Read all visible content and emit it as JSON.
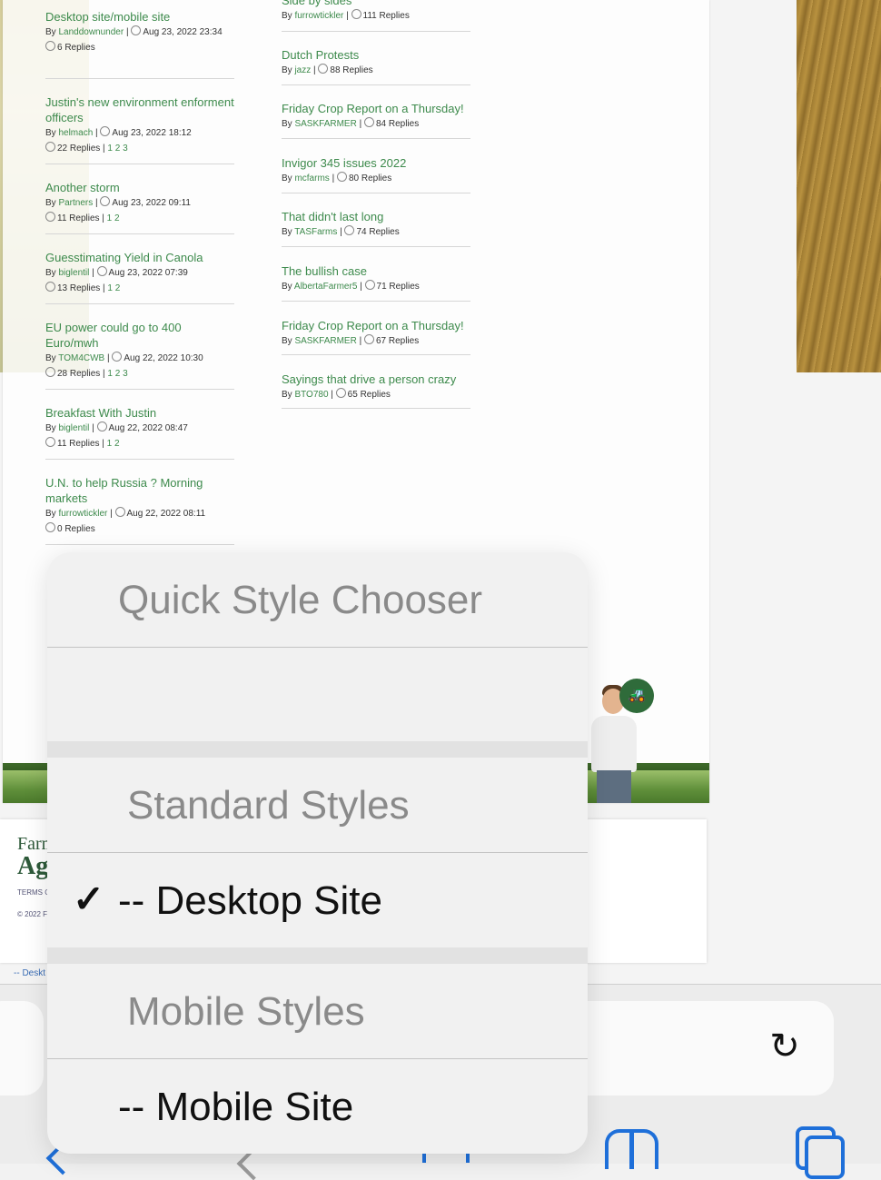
{
  "forum": {
    "left_topics": [
      {
        "title": "Desktop site/mobile site",
        "by": "By",
        "user": "Landdownunder",
        "date": "Aug 23, 2022 23:34",
        "replies": "6 Replies",
        "pages": ""
      },
      {
        "title": "Justin's new environment enforment officers",
        "by": "By",
        "user": "helmach",
        "date": "Aug 23, 2022 18:12",
        "replies": "22 Replies",
        "pages": "1 2 3"
      },
      {
        "title": "Another storm",
        "by": "By",
        "user": "Partners",
        "date": "Aug 23, 2022 09:11",
        "replies": "11 Replies",
        "pages": "1 2"
      },
      {
        "title": "Guesstimating Yield in Canola",
        "by": "By",
        "user": "biglentil",
        "date": "Aug 23, 2022 07:39",
        "replies": "13 Replies",
        "pages": "1 2"
      },
      {
        "title": "EU power could go to 400 Euro/mwh",
        "by": "By",
        "user": "TOM4CWB",
        "date": "Aug 22, 2022 10:30",
        "replies": "28 Replies",
        "pages": "1 2 3"
      },
      {
        "title": "Breakfast With Justin",
        "by": "By",
        "user": "biglentil",
        "date": "Aug 22, 2022 08:47",
        "replies": "11 Replies",
        "pages": "1 2"
      },
      {
        "title": "U.N. to help Russia ? Morning markets",
        "by": "By",
        "user": "furrowtickler",
        "date": "Aug 22, 2022 08:11",
        "replies": "0 Replies",
        "pages": ""
      }
    ],
    "right_topics": [
      {
        "title": "Side by sides",
        "by": "By",
        "user": "furrowtickler",
        "replies": "111 Replies"
      },
      {
        "title": "Dutch Protests",
        "by": "By",
        "user": "jazz",
        "replies": "88 Replies"
      },
      {
        "title": "Friday Crop Report on a Thursday!",
        "by": "By",
        "user": "SASKFARMER",
        "replies": "84 Replies"
      },
      {
        "title": "Invigor 345 issues 2022",
        "by": "By",
        "user": "mcfarms",
        "replies": "80 Replies"
      },
      {
        "title": "That didn't last long",
        "by": "By",
        "user": "TASFarms",
        "replies": "74 Replies"
      },
      {
        "title": "The bullish case",
        "by": "By",
        "user": "AlbertaFarmer5",
        "replies": "71 Replies"
      },
      {
        "title": "Friday Crop Report on a Thursday!",
        "by": "By",
        "user": "SASKFARMER",
        "replies": "67 Replies"
      },
      {
        "title": "Sayings that drive a person crazy",
        "by": "By",
        "user": "BTO780",
        "replies": "65 Replies"
      }
    ]
  },
  "footer": {
    "brand_line1": "Farm",
    "brand_line2": "Ag",
    "terms": "TERMS C",
    "copyright": "© 2022 F",
    "link": "-- Deskt"
  },
  "chat_icon_glyph": "🚜",
  "chooser": {
    "title": "Quick Style Chooser",
    "standard_header": "Standard Styles",
    "desktop_option": "-- Desktop Site",
    "mobile_header": "Mobile Styles",
    "mobile_option": "-- Mobile Site",
    "selected": "-- Desktop Site",
    "checkmark": "✓"
  },
  "toolbar": {
    "reload_glyph": "↻",
    "accent_color": "#1e6fd9"
  }
}
